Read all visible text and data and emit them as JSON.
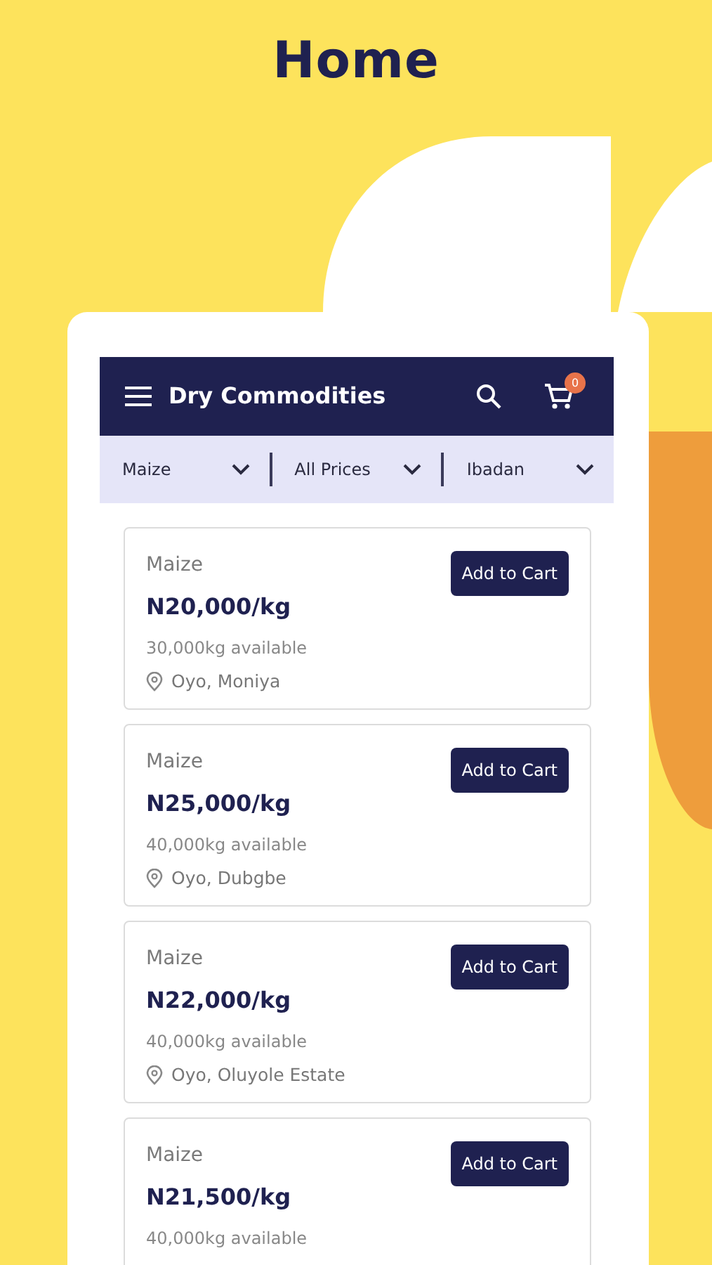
{
  "page_title": "Home",
  "app_bar": {
    "title": "Dry Commodities",
    "cart_count": "0"
  },
  "filters": [
    {
      "label": "Maize"
    },
    {
      "label": "All Prices"
    },
    {
      "label": "Ibadan"
    }
  ],
  "products": [
    {
      "name": "Maize",
      "price": "N20,000/kg",
      "availability": "30,000kg available",
      "location": "Oyo, Moniya",
      "button": "Add to Cart"
    },
    {
      "name": "Maize",
      "price": "N25,000/kg",
      "availability": "40,000kg available",
      "location": "Oyo, Dubgbe",
      "button": "Add to Cart"
    },
    {
      "name": "Maize",
      "price": "N22,000/kg",
      "availability": "40,000kg available",
      "location": "Oyo, Oluyole Estate",
      "button": "Add to Cart"
    },
    {
      "name": "Maize",
      "price": "N21,500/kg",
      "availability": "40,000kg available",
      "button": "Add to Cart"
    }
  ]
}
